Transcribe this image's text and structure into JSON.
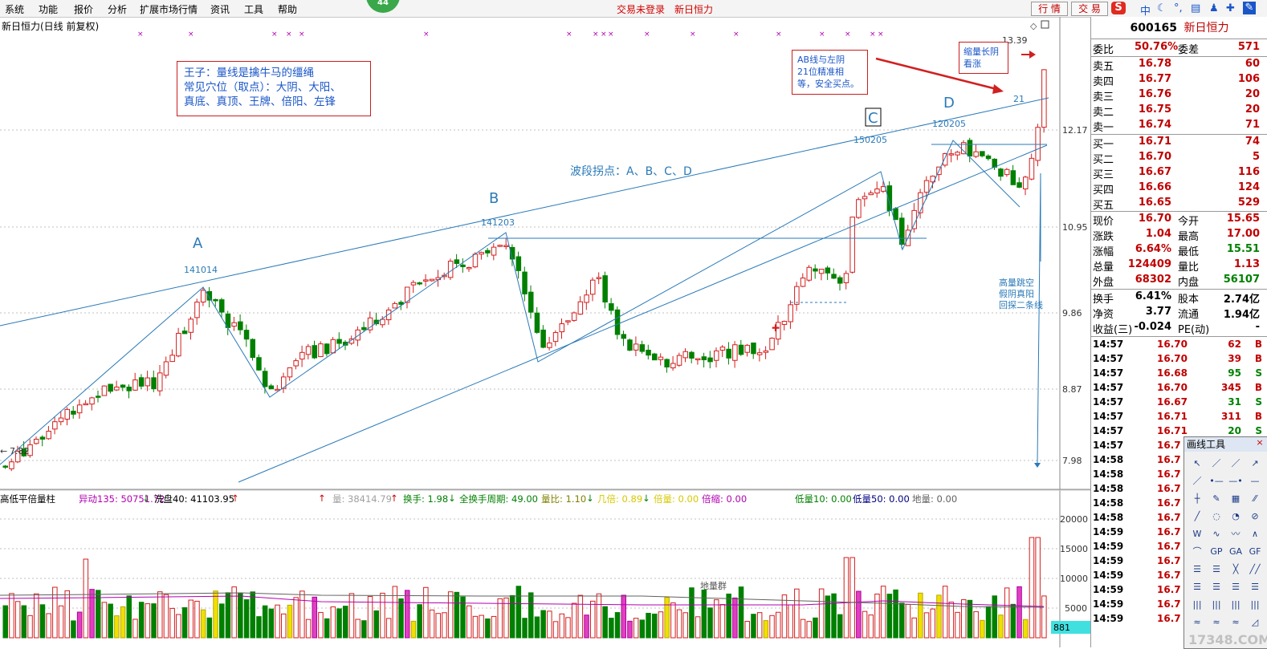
{
  "menu": [
    "系统",
    "功能",
    "报价",
    "分析",
    "扩展市场行情",
    "资讯",
    "工具",
    "帮助"
  ],
  "status": {
    "login": "交易未登录",
    "stock_name": "新日恒力",
    "badge": "44"
  },
  "top_buttons": {
    "quote": "行 情",
    "trade": "交 易"
  },
  "toolbar_icons": [
    "sogou-icon",
    "zhong-text-icon",
    "moon-icon",
    "punctuation-icon",
    "keyboard-icon",
    "user-icon",
    "shirt-icon",
    "wrench-icon"
  ],
  "toolbar_zhong": "中",
  "chart": {
    "title": "新日恒力(日线 前复权)",
    "y_ticks": [
      "12.17",
      "10.95",
      "9.86",
      "8.87",
      "7.98"
    ],
    "min_price_label": "7.82",
    "max_price_label": "13.39",
    "vol_ticks": [
      "20000",
      "15000",
      "10000",
      "5000"
    ],
    "points": {
      "A": "A",
      "B": "B",
      "C": "C",
      "D": "D"
    },
    "dates": {
      "A": "141014",
      "B": "141203",
      "C": "150205",
      "D": "120205"
    },
    "level21": "21",
    "annotations": {
      "box1_line1": "王子：量线是擒牛马的缰绳",
      "box1_line2": "常见穴位（取点）：大阴、大阳、",
      "box1_line3": "真底、真顶、王牌、倍阳、左锋",
      "waves": "波段拐点：A、B、C、D",
      "box2_line1": "AB线与左阴",
      "box2_line2": "21位精准相",
      "box2_line3": "等，安全买点。",
      "box3_line1": "缩量长阴",
      "box3_line2": "看涨",
      "note_line1": "高量跳空",
      "note_line2": "假阴真阳",
      "note_line3": "回探二条线",
      "ground_group": "地量群"
    }
  },
  "volume_bar": {
    "name": "高低平倍量柱",
    "items": [
      {
        "label": "异动135: 50751.72",
        "arrow": "↓",
        "color": "#b200b2"
      },
      {
        "label": "洗盘40: 41103.95",
        "arrow": "↑",
        "color": "#000000"
      },
      {
        "label": "量: 38414.79",
        "arrow": "↑",
        "color": "#a0a0a0"
      },
      {
        "label": "换手: 1.98",
        "arrow": "↓",
        "color": "#008000"
      },
      {
        "label": "全换手周期: 49.00",
        "arrow": "",
        "color": "#008000"
      },
      {
        "label": "量比: 1.10",
        "arrow": "↓",
        "color": "#808000"
      },
      {
        "label": "几倍: 0.89",
        "arrow": "↓",
        "color": "#e0e000"
      },
      {
        "label": "倍量: 0.00",
        "arrow": "",
        "color": "#e0e000"
      },
      {
        "label": "倍缩: 0.00",
        "arrow": "",
        "color": "#b200b2"
      },
      {
        "label": "低量10: 0.00",
        "arrow": "",
        "color": "#008000"
      },
      {
        "label": "低量50: 0.00",
        "arrow": "",
        "color": "#000080"
      },
      {
        "label": "地量: 0.00",
        "arrow": "",
        "color": "#606060"
      }
    ],
    "cyan_value": "881"
  },
  "quote": {
    "code": "600165",
    "name": "新日恒力",
    "weibi_label": "委比",
    "weibi": "50.76%",
    "weicha_label": "委差",
    "weicha": "571",
    "sells": [
      {
        "label": "卖五",
        "price": "16.78",
        "vol": "60"
      },
      {
        "label": "卖四",
        "price": "16.77",
        "vol": "106"
      },
      {
        "label": "卖三",
        "price": "16.76",
        "vol": "20"
      },
      {
        "label": "卖二",
        "price": "16.75",
        "vol": "20"
      },
      {
        "label": "卖一",
        "price": "16.74",
        "vol": "71"
      }
    ],
    "buys": [
      {
        "label": "买一",
        "price": "16.71",
        "vol": "74"
      },
      {
        "label": "买二",
        "price": "16.70",
        "vol": "5"
      },
      {
        "label": "买三",
        "price": "16.67",
        "vol": "116"
      },
      {
        "label": "买四",
        "price": "16.66",
        "vol": "124"
      },
      {
        "label": "买五",
        "price": "16.65",
        "vol": "529"
      }
    ],
    "stats": [
      {
        "l1": "现价",
        "v1": "16.70",
        "l2": "今开",
        "v2": "15.65"
      },
      {
        "l1": "涨跌",
        "v1": "1.04",
        "l2": "最高",
        "v2": "17.00"
      },
      {
        "l1": "涨幅",
        "v1": "6.64%",
        "l2": "最低",
        "v2": "15.51"
      },
      {
        "l1": "总量",
        "v1": "124409",
        "l2": "量比",
        "v2": "1.13"
      },
      {
        "l1": "外盘",
        "v1": "68302",
        "l2": "内盘",
        "v2": "56107"
      }
    ],
    "stats2": [
      {
        "l1": "换手",
        "v1": "6.41%",
        "l2": "股本",
        "v2": "2.74亿"
      },
      {
        "l1": "净资",
        "v1": "3.77",
        "l2": "流通",
        "v2": "1.94亿"
      },
      {
        "l1": "收益(三)",
        "v1": "-0.024",
        "l2": "PE(动)",
        "v2": "-"
      }
    ],
    "ticks": [
      {
        "t": "14:57",
        "p": "16.70",
        "v": "62",
        "s": "B"
      },
      {
        "t": "14:57",
        "p": "16.70",
        "v": "39",
        "s": "B"
      },
      {
        "t": "14:57",
        "p": "16.68",
        "v": "95",
        "s": "S"
      },
      {
        "t": "14:57",
        "p": "16.70",
        "v": "345",
        "s": "B"
      },
      {
        "t": "14:57",
        "p": "16.67",
        "v": "31",
        "s": "S"
      },
      {
        "t": "14:57",
        "p": "16.71",
        "v": "311",
        "s": "B"
      },
      {
        "t": "14:57",
        "p": "16.71",
        "v": "20",
        "s": "S"
      },
      {
        "t": "14:57",
        "p": "16.7",
        "v": "",
        "s": ""
      },
      {
        "t": "14:58",
        "p": "16.7",
        "v": "",
        "s": ""
      },
      {
        "t": "14:58",
        "p": "16.7",
        "v": "",
        "s": ""
      },
      {
        "t": "14:58",
        "p": "16.7",
        "v": "",
        "s": ""
      },
      {
        "t": "14:58",
        "p": "16.7",
        "v": "",
        "s": ""
      },
      {
        "t": "14:58",
        "p": "16.7",
        "v": "",
        "s": ""
      },
      {
        "t": "14:59",
        "p": "16.7",
        "v": "",
        "s": ""
      },
      {
        "t": "14:59",
        "p": "16.7",
        "v": "",
        "s": ""
      },
      {
        "t": "14:59",
        "p": "16.7",
        "v": "",
        "s": ""
      },
      {
        "t": "14:59",
        "p": "16.7",
        "v": "",
        "s": ""
      },
      {
        "t": "14:59",
        "p": "16.7",
        "v": "",
        "s": ""
      },
      {
        "t": "14:59",
        "p": "16.7",
        "v": "",
        "s": ""
      },
      {
        "t": "14:59",
        "p": "16.7",
        "v": "",
        "s": ""
      }
    ]
  },
  "draw_tools": {
    "title": "画线工具",
    "close": "×",
    "tools": [
      "↖",
      "／",
      "／",
      "↗",
      "／",
      "•—",
      "—•",
      "—",
      "┼",
      "✎",
      "▦",
      "⁄⁄",
      "╱",
      "◌",
      "◔",
      "⊘",
      "W",
      "∿",
      "〰",
      "∧",
      "⌒",
      "GP",
      "GA",
      "GF",
      "☰",
      "☰",
      "╳",
      "╱╱",
      "☰",
      "☰",
      "☰",
      "☰",
      "|||",
      "|||",
      "|||",
      "|||",
      "≈",
      "≈",
      "≈",
      "◿"
    ]
  },
  "watermark": "17348.COM"
}
